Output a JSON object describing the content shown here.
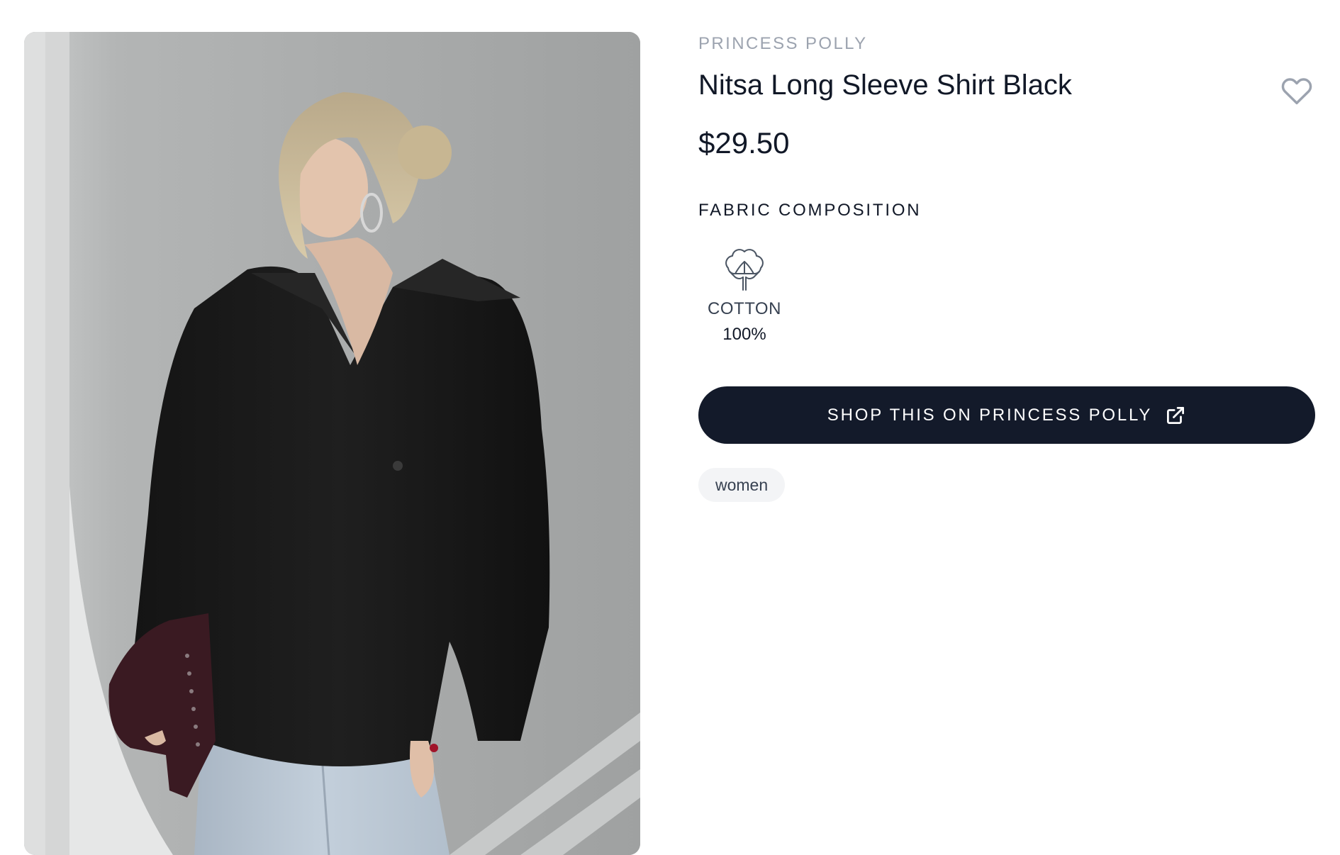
{
  "product": {
    "brand": "PRINCESS POLLY",
    "title": "Nitsa Long Sleeve Shirt Black",
    "price": "$29.50",
    "image_alt": "Model wearing Nitsa Long Sleeve Shirt Black"
  },
  "fabric": {
    "heading": "FABRIC COMPOSITION",
    "items": [
      {
        "name": "COTTON",
        "percent": "100%",
        "icon": "cotton-flower-icon"
      }
    ]
  },
  "actions": {
    "shop_label": "SHOP THIS ON PRINCESS POLLY",
    "shop_icon": "external-link-icon",
    "favorite_icon": "heart-outline-icon"
  },
  "tags": [
    "women"
  ],
  "colors": {
    "button_bg": "#131a2a",
    "brand_text": "#9ca3af",
    "tag_bg": "#f3f4f6",
    "heart_stroke": "#9ca3af"
  }
}
